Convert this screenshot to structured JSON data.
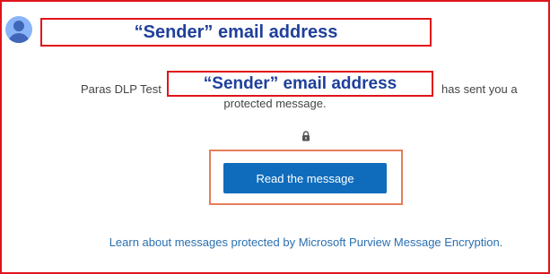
{
  "annotation": {
    "top_label": "“Sender” email address",
    "inline_label": "“Sender” email address"
  },
  "message": {
    "sender_prefix": "Paras DLP Test",
    "sender_suffix": "has sent you a",
    "line2": "protected message."
  },
  "actions": {
    "read_button": "Read the message",
    "learn_more": "Learn about messages protected by Microsoft Purview Message Encryption."
  },
  "icons": {
    "avatar": "person-avatar-icon",
    "lock": "lock-icon"
  },
  "colors": {
    "callout_border": "#e0141b",
    "callout_text": "#1f3f9a",
    "button_bg": "#0f6cbd",
    "button_highlight": "#e67e5a",
    "link": "#2a6fb0",
    "avatar_bg": "#8ab4f8"
  }
}
